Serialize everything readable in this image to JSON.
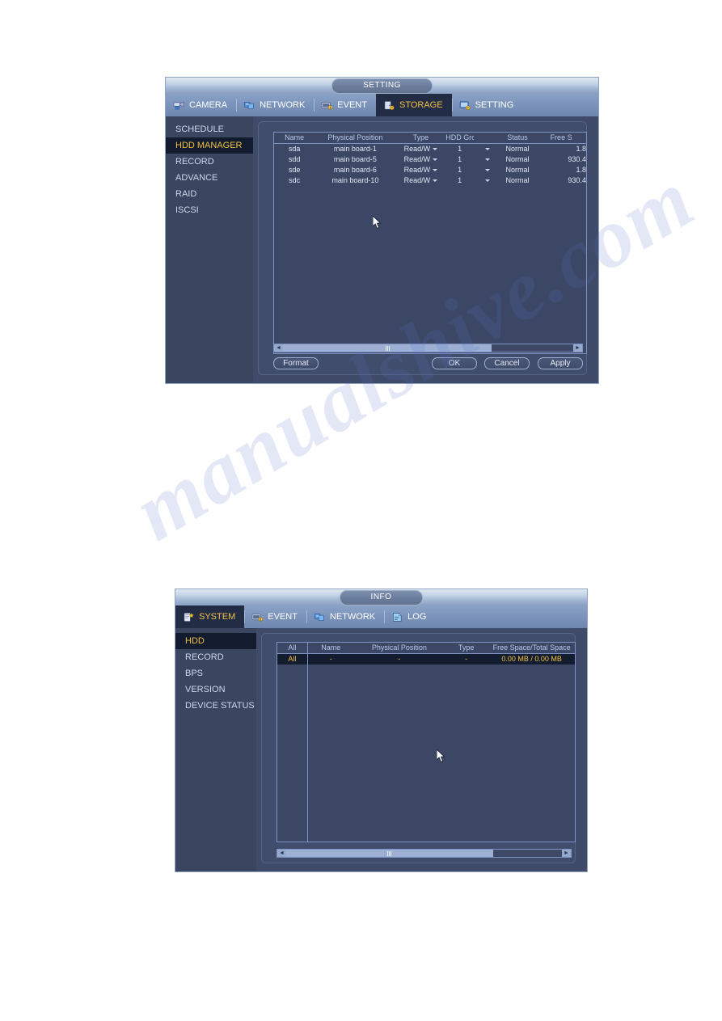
{
  "page": {
    "watermark": "manualshive.com",
    "background_color": "#ffffff"
  },
  "theme": {
    "panel_bg": "#3a4560",
    "accent_yellow": "#f0c040",
    "tab_active_bg": "#222c44",
    "titlebar_light": "#c3d2e6",
    "table_border": "#7e92c4"
  },
  "window_setting": {
    "title": "SETTING",
    "tabs": [
      {
        "label": "CAMERA",
        "icon": "camera-icon",
        "active": false
      },
      {
        "label": "NETWORK",
        "icon": "network-icon",
        "active": false
      },
      {
        "label": "EVENT",
        "icon": "event-icon",
        "active": false
      },
      {
        "label": "STORAGE",
        "icon": "storage-icon",
        "active": true
      },
      {
        "label": "SETTING",
        "icon": "setting-icon",
        "active": false
      }
    ],
    "sidebar": [
      {
        "label": "SCHEDULE",
        "active": false
      },
      {
        "label": "HDD MANAGER",
        "active": true
      },
      {
        "label": "RECORD",
        "active": false
      },
      {
        "label": "ADVANCE",
        "active": false
      },
      {
        "label": "RAID",
        "active": false
      },
      {
        "label": "ISCSI",
        "active": false
      }
    ],
    "table": {
      "columns": [
        "Name",
        "Physical Position",
        "Type",
        "HDD Group",
        "Status",
        "Free S"
      ],
      "rows": [
        {
          "name": "sda",
          "position": "main board-1",
          "type": "Read/W",
          "group": "1",
          "status": "Normal",
          "free": "1.8"
        },
        {
          "name": "sdd",
          "position": "main board-5",
          "type": "Read/W",
          "group": "1",
          "status": "Normal",
          "free": "930.4"
        },
        {
          "name": "sde",
          "position": "main board-6",
          "type": "Read/W",
          "group": "1",
          "status": "Normal",
          "free": "1.8"
        },
        {
          "name": "sdc",
          "position": "main board-10",
          "type": "Read/W",
          "group": "1",
          "status": "Normal",
          "free": "930.4"
        }
      ]
    },
    "scrollbar": {
      "left_arrow": "◄",
      "right_arrow": "►"
    },
    "buttons": {
      "format": "Format",
      "ok": "OK",
      "cancel": "Cancel",
      "apply": "Apply"
    }
  },
  "window_info": {
    "title": "INFO",
    "tabs": [
      {
        "label": "SYSTEM",
        "icon": "system-icon",
        "active": true
      },
      {
        "label": "EVENT",
        "icon": "event-icon",
        "active": false
      },
      {
        "label": "NETWORK",
        "icon": "network-icon",
        "active": false
      },
      {
        "label": "LOG",
        "icon": "log-icon",
        "active": false
      }
    ],
    "sidebar": [
      {
        "label": "HDD",
        "active": true
      },
      {
        "label": "RECORD",
        "active": false
      },
      {
        "label": "BPS",
        "active": false
      },
      {
        "label": "VERSION",
        "active": false
      },
      {
        "label": "DEVICE STATUS",
        "active": false
      }
    ],
    "table": {
      "columns": [
        "All",
        "Name",
        "Physical Position",
        "Type",
        "Free Space/Total Space"
      ],
      "rows": [
        {
          "all": "All",
          "name": "-",
          "position": "-",
          "type": "-",
          "space": "0.00 MB / 0.00 MB",
          "selected": true
        }
      ]
    },
    "scrollbar": {
      "left_arrow": "◄",
      "right_arrow": "►"
    }
  }
}
